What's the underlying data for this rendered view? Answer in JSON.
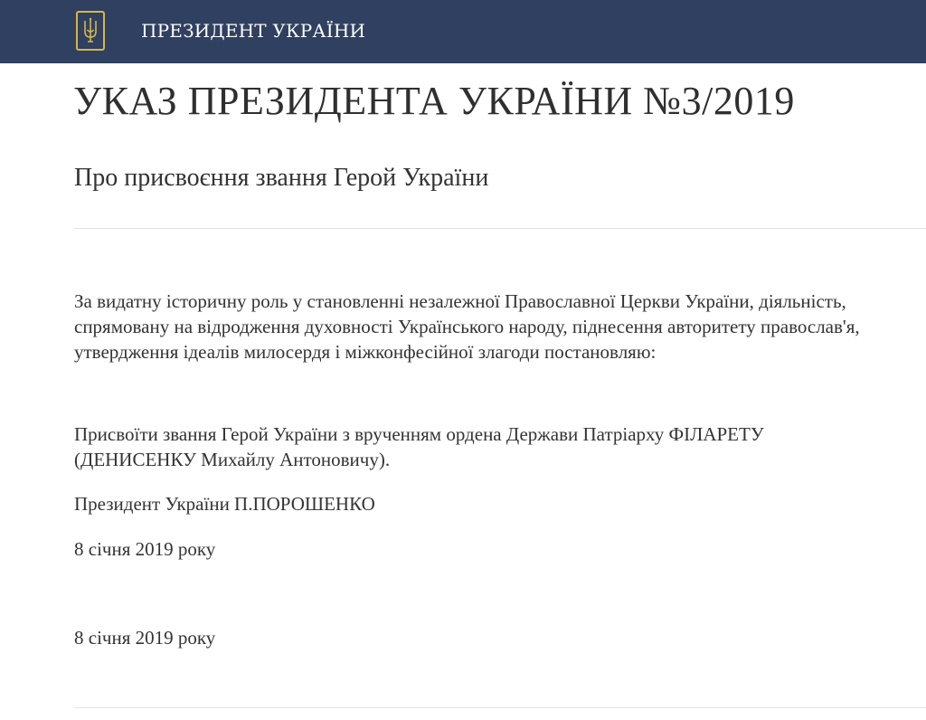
{
  "header": {
    "site_title": "ПРЕЗИДЕНТ УКРАЇНИ",
    "emblem_icon": "trident-coat-of-arms-icon",
    "background_color": "#2f4060",
    "emblem_color": "#d7b64a"
  },
  "decree": {
    "title": "УКАЗ ПРЕЗИДЕНТА УКРАЇНИ №3/2019",
    "subtitle": "Про присвоєння звання Герой України",
    "paragraphs": [
      "За видатну історичну роль у становленні незалежної Православної Церкви України, діяльність, спрямовану на відродження духовності Українського народу, піднесення авторитету православ'я, утвердження ідеалів милосердя і міжконфесійної злагоди постановляю:",
      "Присвоїти звання Герой України з врученням ордена Держави Патріарху ФІЛАРЕТУ (ДЕНИСЕНКУ Михайлу Антоновичу).",
      "Президент України П.ПОРОШЕНКО",
      "8 січня 2019 року"
    ],
    "publication_date": "8 січня 2019 року"
  }
}
